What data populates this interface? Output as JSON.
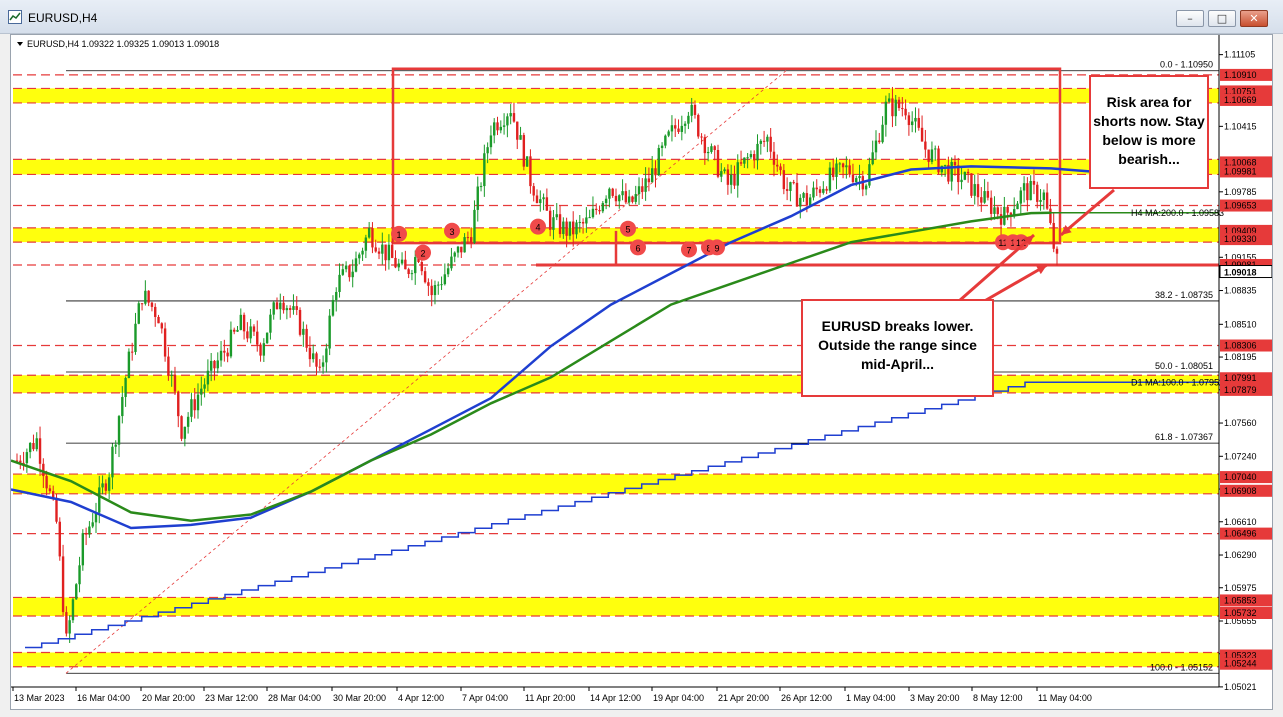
{
  "window": {
    "title": "EURUSD,H4",
    "buttons": {
      "minimize": "–",
      "maximize": "□",
      "close": "✕"
    }
  },
  "chart_data": {
    "type": "candlestick",
    "symbol_header": "EURUSD,H4  1.09322 1.09325 1.09013 1.09018",
    "ylim": [
      1.0502,
      1.1114
    ],
    "y_ticks": [
      "1.11105",
      "1.10415",
      "1.09785",
      "1.09155",
      "1.08835",
      "1.08510",
      "1.08195",
      "1.07880",
      "1.07560",
      "1.07240",
      "1.06925",
      "1.06610",
      "1.06290",
      "1.05975",
      "1.05655",
      "1.05340",
      "1.05021"
    ],
    "x_labels": [
      "13 Mar 2023",
      "16 Mar 04:00",
      "20 Mar 20:00",
      "23 Mar 12:00",
      "28 Mar 04:00",
      "30 Mar 20:00",
      "4 Apr 12:00",
      "7 Apr 04:00",
      "11 Apr 20:00",
      "14 Apr 12:00",
      "19 Apr 04:00",
      "21 Apr 20:00",
      "26 Apr 12:00",
      "1 May 04:00",
      "3 May 20:00",
      "8 May 12:00",
      "11 May 04:00"
    ],
    "price_tags": [
      {
        "value": 1.1091,
        "label": "1.10910"
      },
      {
        "value": 1.10751,
        "label": "1.10751"
      },
      {
        "value": 1.10669,
        "label": "1.10669"
      },
      {
        "value": 1.10068,
        "label": "1.10068"
      },
      {
        "value": 1.09981,
        "label": "1.09981"
      },
      {
        "value": 1.09653,
        "label": "1.09653"
      },
      {
        "value": 1.09409,
        "label": "1.09409"
      },
      {
        "value": 1.0933,
        "label": "1.09330"
      },
      {
        "value": 1.09081,
        "label": "1.09081"
      },
      {
        "value": 1.08306,
        "label": "1.08306"
      },
      {
        "value": 1.07991,
        "label": "1.07991"
      },
      {
        "value": 1.07879,
        "label": "1.07879"
      },
      {
        "value": 1.0704,
        "label": "1.07040"
      },
      {
        "value": 1.06908,
        "label": "1.06908"
      },
      {
        "value": 1.06496,
        "label": "1.06496"
      },
      {
        "value": 1.05853,
        "label": "1.05853"
      },
      {
        "value": 1.05732,
        "label": "1.05732"
      },
      {
        "value": 1.05323,
        "label": "1.05323"
      },
      {
        "value": 1.05244,
        "label": "1.05244"
      }
    ],
    "current_price": {
      "value": 1.09018,
      "label": "1.09018"
    },
    "fib_levels": [
      {
        "label": "0.0 - 1.10950",
        "value": 1.1095
      },
      {
        "label": "38.2 - 1.08735",
        "value": 1.08735
      },
      {
        "label": "50.0 - 1.08051",
        "value": 1.08051
      },
      {
        "label": "61.8 - 1.07367",
        "value": 1.07367
      },
      {
        "label": "100.0 - 1.05152",
        "value": 1.05152
      }
    ],
    "ma_labels": [
      {
        "label": "H4 MA:200.0 - 1.09583",
        "value": 1.09583
      },
      {
        "label": "D1 MA:100.0 - 1.07952",
        "value": 1.07952
      }
    ],
    "yellow_bands": [
      [
        1.10669,
        1.10751
      ],
      [
        1.09981,
        1.10068
      ],
      [
        1.0933,
        1.09409
      ],
      [
        1.07879,
        1.07991
      ],
      [
        1.06908,
        1.0704
      ],
      [
        1.05732,
        1.05853
      ],
      [
        1.05244,
        1.05323
      ]
    ],
    "dashed_levels": [
      1.1091,
      1.09653,
      1.09081,
      1.08306,
      1.06496
    ],
    "swing_markers": [
      "1",
      "2",
      "3",
      "4",
      "5",
      "6",
      "7",
      "8",
      "9",
      "11",
      "1",
      "12"
    ],
    "annotations": {
      "risk": "Risk area for shorts now. Stay below is more bearish...",
      "breaks": "EURUSD breaks lower. Outside the range since mid-April..."
    },
    "colors": {
      "bull": "#1a9a2a",
      "bear": "#e02020",
      "ma_blue": "#1f3fd0",
      "ma_green": "#2a8a1a",
      "band": "#ffff00",
      "red": "#e63a3a"
    }
  }
}
